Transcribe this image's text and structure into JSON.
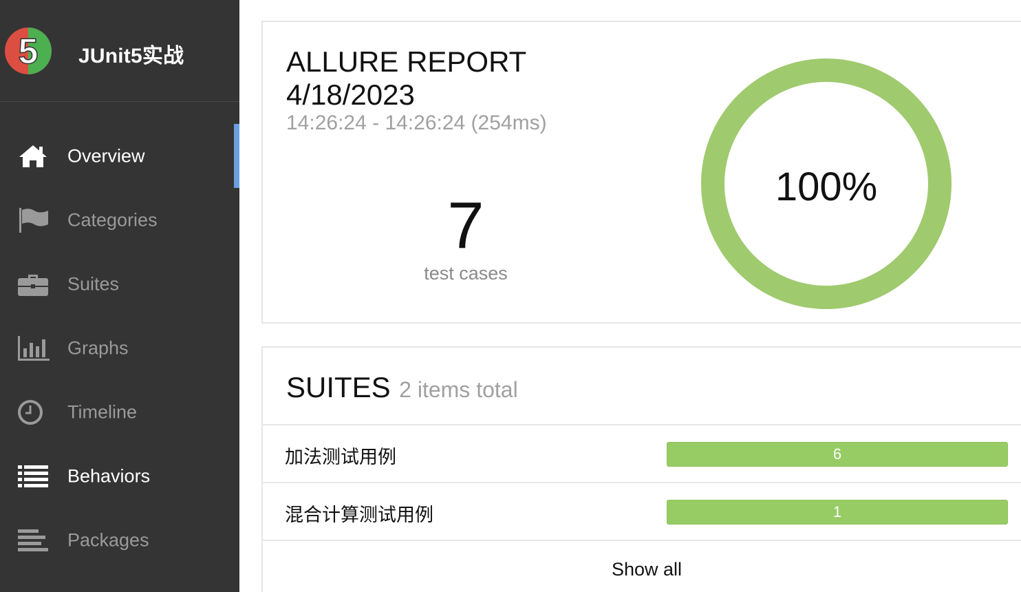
{
  "app": {
    "logo_text": "5",
    "title": "JUnit5实战"
  },
  "sidebar": {
    "items": [
      {
        "label": "Overview",
        "icon": "home-icon",
        "active": true
      },
      {
        "label": "Categories",
        "icon": "flag-icon",
        "active": false
      },
      {
        "label": "Suites",
        "icon": "briefcase-icon",
        "active": false
      },
      {
        "label": "Graphs",
        "icon": "bar-chart-icon",
        "active": false
      },
      {
        "label": "Timeline",
        "icon": "clock-icon",
        "active": false
      },
      {
        "label": "Behaviors",
        "icon": "list-icon",
        "active": false
      },
      {
        "label": "Packages",
        "icon": "align-left-icon",
        "active": false
      }
    ]
  },
  "summary": {
    "title": "ALLURE REPORT",
    "date": "4/18/2023",
    "time_range": "14:26:24 - 14:26:24 (254ms)",
    "test_count": "7",
    "test_count_label": "test cases",
    "pass_percent": "100%",
    "pass_fraction": 1.0
  },
  "suites": {
    "title": "SUITES",
    "total_label": "2 items total",
    "rows": [
      {
        "name": "加法测试用例",
        "count": "6"
      },
      {
        "name": "混合计算测试用例",
        "count": "1"
      }
    ],
    "show_all_label": "Show all"
  },
  "colors": {
    "sidebar_bg": "#343434",
    "active_indicator": "#6aa0df",
    "passed": "#97cc64",
    "logo_red": "#dc4e41",
    "logo_green": "#4caf50"
  }
}
